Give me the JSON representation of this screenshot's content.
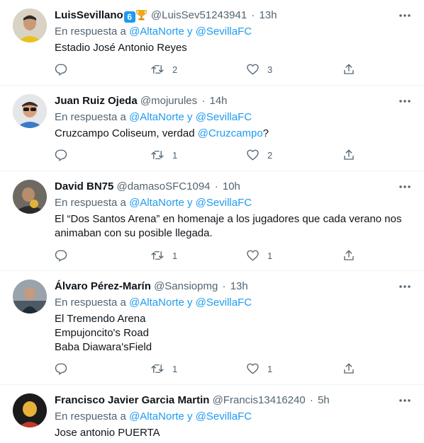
{
  "tweets": [
    {
      "name": "LuisSevillano",
      "badge_number": "6",
      "handle": "@LuisSev51243941",
      "time": "13h",
      "reply_prefix": "En respuesta a",
      "reply_mention1": "@AltaNorte",
      "reply_conj": "y",
      "reply_mention2": "@SevillaFC",
      "lines": [
        "Estadio José Antonio Reyes"
      ],
      "retweets": "2",
      "likes": "3"
    },
    {
      "name": "Juan Ruiz Ojeda",
      "handle": "@mojurules",
      "time": "14h",
      "reply_prefix": "En respuesta a",
      "reply_mention1": "@AltaNorte",
      "reply_conj": "y",
      "reply_mention2": "@SevillaFC",
      "text_before": "Cruzcampo Coliseum, verdad ",
      "text_mention": "@Cruzcampo",
      "text_after": "?",
      "retweets": "1",
      "likes": "2"
    },
    {
      "name": "David BN75",
      "handle": "@damasoSFC1094",
      "time": "10h",
      "reply_prefix": "En respuesta a",
      "reply_mention1": "@AltaNorte",
      "reply_conj": "y",
      "reply_mention2": "@SevillaFC",
      "lines": [
        "El “Dos Santos Arena” en homenaje a los jugadores que cada verano nos",
        "animaban con su posible llegada."
      ],
      "retweets": "1",
      "likes": "1"
    },
    {
      "name": "Álvaro Pérez-Marín",
      "handle": "@Sansiopmg",
      "time": "13h",
      "reply_prefix": "En respuesta a",
      "reply_mention1": "@AltaNorte",
      "reply_conj": "y",
      "reply_mention2": "@SevillaFC",
      "lines": [
        "El Tremendo Arena",
        "Empujoncito's Road",
        "Baba Diawara'sField"
      ],
      "retweets": "1",
      "likes": "1"
    },
    {
      "name": "Francisco Javier Garcia Martin",
      "handle": "@Francis13416240",
      "time": "5h",
      "reply_prefix": "En respuesta a",
      "reply_mention1": "@AltaNorte",
      "reply_conj": "y",
      "reply_mention2": "@SevillaFC",
      "lines": [
        "Jose antonio PUERTA"
      ]
    }
  ],
  "head_separator": "·",
  "icons": {
    "reply": "reply-icon",
    "retweet": "retweet-icon",
    "like": "like-icon",
    "share": "share-icon",
    "more": "more-icon",
    "trophy": "trophy-icon"
  },
  "colors": {
    "text": "#0f1419",
    "secondary": "#536471",
    "accent": "#1d9bf0",
    "divider": "#eff3f4"
  }
}
